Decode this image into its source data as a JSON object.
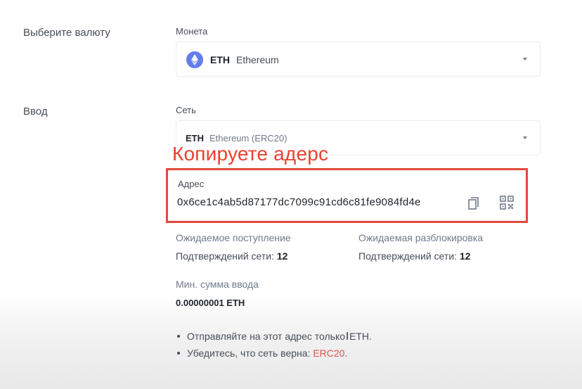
{
  "select_currency": {
    "section_label": "Выберите валюту",
    "field_label": "Монета",
    "coin_symbol": "ETH",
    "coin_name": "Ethereum"
  },
  "deposit": {
    "section_label": "Ввод",
    "network_label": "Сеть",
    "network_symbol": "ETH",
    "network_name": "Ethereum (ERC20)"
  },
  "annotation": "Копируете адерс",
  "address": {
    "label": "Адрес",
    "value": "0x6ce1c4ab5d87177dc7099c91cd6c81fe9084fd4e",
    "copy_icon": "copy-icon",
    "qr_icon": "qr-code-icon"
  },
  "expected_arrival": {
    "label": "Ожидаемое поступление",
    "text": "Подтверждений сети:",
    "value": "12"
  },
  "expected_unlock": {
    "label": "Ожидаемая разблокировка",
    "text": "Подтверждений сети:",
    "value": "12"
  },
  "min_deposit": {
    "label": "Мин. сумма ввода",
    "value": "0.00000001 ETH"
  },
  "notes": {
    "note1_prefix": "Отправляйте на этот адрес только",
    "note1_suffix": "ETH.",
    "note2_prefix": "Убедитесь, что сеть верна:",
    "note2_link": "ERC20",
    "note2_suffix": "."
  },
  "colors": {
    "annotation": "#e8412f",
    "highlight_border": "#e24a3b",
    "eth_icon": "#627eea",
    "link": "#d9534f"
  }
}
